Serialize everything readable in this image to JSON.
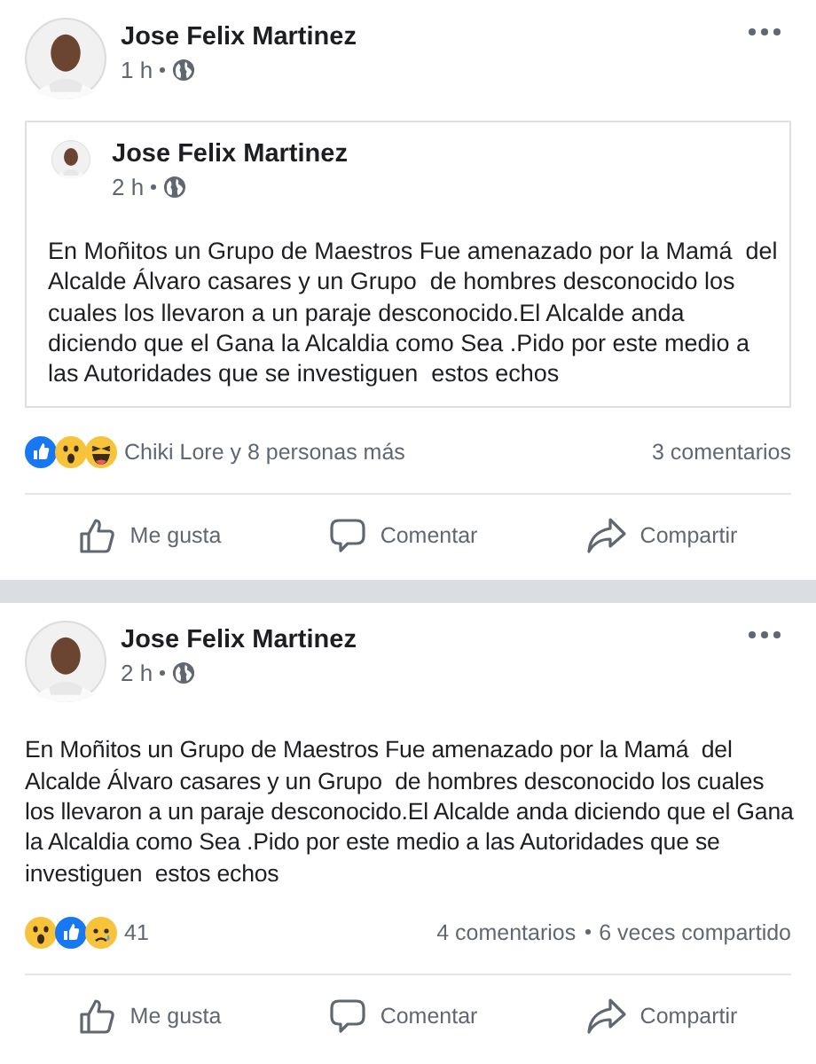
{
  "posts": [
    {
      "author": "Jose Felix Martinez",
      "time": "1 h",
      "shared_post": {
        "author": "Jose Felix Martinez",
        "time": "2 h",
        "text": "En Moñitos un Grupo de Maestros Fue amenazado por la Mamá  del Alcalde Álvaro casares y un Grupo  de hombres desconocido los cuales los llevaron a un paraje desconocido.El Alcalde anda diciendo que el Gana la Alcaldia como Sea .Pido por este medio a las Autoridades que se investiguen  estos echos"
      },
      "reactions": [
        {
          "kind": "like"
        },
        {
          "kind": "wow"
        },
        {
          "kind": "haha"
        }
      ],
      "reaction_summary": "Chiki Lore y 8 personas más",
      "comments": "3 comentarios",
      "actions": [
        {
          "kind": "like",
          "label": "Me gusta"
        },
        {
          "kind": "comment",
          "label": "Comentar"
        },
        {
          "kind": "share",
          "label": "Compartir"
        }
      ]
    },
    {
      "author": "Jose Felix Martinez",
      "time": "2 h",
      "text": "En Moñitos un Grupo de Maestros Fue amenazado por la Mamá  del Alcalde Álvaro casares y un Grupo  de hombres desconocido los cuales los llevaron a un paraje desconocido.El Alcalde anda diciendo que el Gana la Alcaldia como Sea .Pido por este medio a las Autoridades que se investiguen  estos echos",
      "reactions": [
        {
          "kind": "wow"
        },
        {
          "kind": "like"
        },
        {
          "kind": "sad"
        }
      ],
      "reaction_summary": "41",
      "comments": "4 comentarios",
      "shares": "6 veces compartido",
      "actions": [
        {
          "kind": "like",
          "label": "Me gusta"
        },
        {
          "kind": "comment",
          "label": "Comentar"
        },
        {
          "kind": "share",
          "label": "Compartir"
        }
      ]
    }
  ]
}
